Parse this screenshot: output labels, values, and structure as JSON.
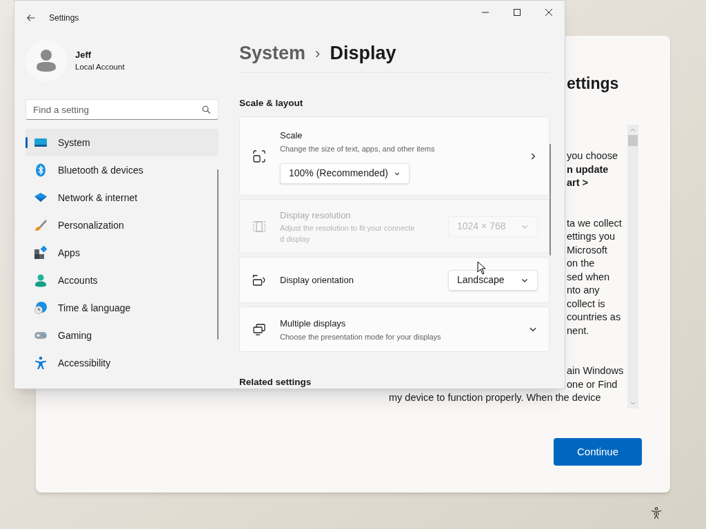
{
  "background_window": {
    "title": "ettings",
    "paragraphs": [
      [
        {
          "text": "you choose",
          "bold": false
        },
        {
          "text": "n update",
          "bold": true
        },
        {
          "text": "art >",
          "bold": true
        }
      ],
      [
        {
          "text": "ta we collect",
          "bold": false
        },
        {
          "text": "ettings you",
          "bold": false
        },
        {
          "text": "Microsoft",
          "bold": false
        },
        {
          "text": "on the",
          "bold": false
        },
        {
          "text": "sed when",
          "bold": false
        },
        {
          "text": "nto any",
          "bold": false
        },
        {
          "text": "collect is",
          "bold": false
        },
        {
          "text": "countries as",
          "bold": false
        },
        {
          "text": "nent.",
          "bold": false
        }
      ],
      [
        {
          "text": "ain Windows",
          "bold": false
        },
        {
          "text": "one or Find",
          "bold": false
        },
        {
          "text": "my device to function properly. When the device",
          "bold": false,
          "full": true
        }
      ]
    ],
    "continue_button": "Continue"
  },
  "window": {
    "title": "Settings"
  },
  "profile": {
    "name": "Jeff",
    "account": "Local Account"
  },
  "search": {
    "placeholder": "Find a setting"
  },
  "nav": [
    {
      "label": "System",
      "selected": true
    },
    {
      "label": "Bluetooth & devices",
      "selected": false
    },
    {
      "label": "Network & internet",
      "selected": false
    },
    {
      "label": "Personalization",
      "selected": false
    },
    {
      "label": "Apps",
      "selected": false
    },
    {
      "label": "Accounts",
      "selected": false
    },
    {
      "label": "Time & language",
      "selected": false
    },
    {
      "label": "Gaming",
      "selected": false
    },
    {
      "label": "Accessibility",
      "selected": false
    }
  ],
  "breadcrumb": {
    "parent": "System",
    "separator": "›",
    "current": "Display"
  },
  "section": "Scale & layout",
  "settings": [
    {
      "kind": "scale",
      "title": "Scale",
      "description": "Change the size of text, apps, and other items",
      "value": "100% (Recommended)",
      "disabled": false,
      "navigates": true,
      "expandable": false
    },
    {
      "kind": "resolution",
      "title": "Display resolution",
      "description": "Adjust the resolution to fit your connected display",
      "value": "1024 × 768",
      "disabled": true
    },
    {
      "kind": "orientation",
      "title": "Display orientation",
      "value": "Landscape",
      "disabled": false
    },
    {
      "kind": "multiple",
      "title": "Multiple displays",
      "description": "Choose the presentation mode for your displays",
      "disabled": false,
      "navigates": false,
      "expandable": true
    }
  ],
  "related_heading": "Related settings"
}
